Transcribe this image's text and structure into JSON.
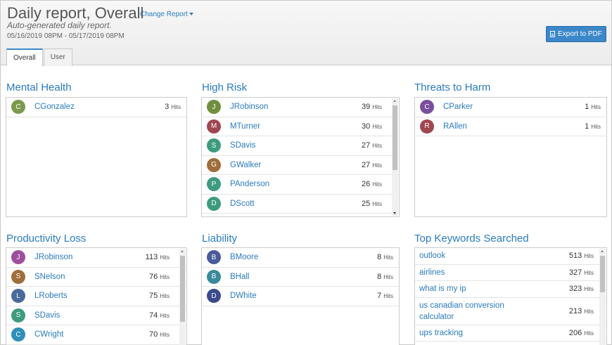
{
  "header": {
    "title": "Daily report, Overall",
    "change_report": "Change Report",
    "subtitle": "Auto-generated daily report.",
    "date_range": "05/16/2019 08PM - 05/17/2019 08PM",
    "export_label": "Export to PDF"
  },
  "tabs": [
    {
      "label": "Overall",
      "active": true
    },
    {
      "label": "User",
      "active": false
    }
  ],
  "hits_label": "Hits",
  "panels": {
    "mental_health": {
      "title": "Mental Health",
      "rows": [
        {
          "initial": "C",
          "name": "CGonzalez",
          "count": "3",
          "color": "#7a9a4e"
        }
      ]
    },
    "high_risk": {
      "title": "High Risk",
      "rows": [
        {
          "initial": "J",
          "name": "JRobinson",
          "count": "39",
          "color": "#6f8f3f"
        },
        {
          "initial": "M",
          "name": "MTurner",
          "count": "30",
          "color": "#a04650"
        },
        {
          "initial": "S",
          "name": "SDavis",
          "count": "27",
          "color": "#3d9b7e"
        },
        {
          "initial": "G",
          "name": "GWalker",
          "count": "27",
          "color": "#a06d3c"
        },
        {
          "initial": "P",
          "name": "PAnderson",
          "count": "26",
          "color": "#3d9b7e"
        },
        {
          "initial": "D",
          "name": "DScott",
          "count": "25",
          "color": "#3d9b7e"
        }
      ]
    },
    "threats": {
      "title": "Threats to Harm",
      "rows": [
        {
          "initial": "C",
          "name": "CParker",
          "count": "1",
          "color": "#7a4d9e"
        },
        {
          "initial": "R",
          "name": "RAllen",
          "count": "1",
          "color": "#a04650"
        }
      ]
    },
    "productivity": {
      "title": "Productivity Loss",
      "rows": [
        {
          "initial": "J",
          "name": "JRobinson",
          "count": "113",
          "color": "#9d4f9e"
        },
        {
          "initial": "S",
          "name": "SNelson",
          "count": "76",
          "color": "#a06d3c"
        },
        {
          "initial": "L",
          "name": "LRoberts",
          "count": "75",
          "color": "#4a6a9b"
        },
        {
          "initial": "S",
          "name": "SDavis",
          "count": "74",
          "color": "#3d9b7e"
        },
        {
          "initial": "C",
          "name": "CWright",
          "count": "70",
          "color": "#2f8fb8"
        }
      ]
    },
    "liability": {
      "title": "Liability",
      "rows": [
        {
          "initial": "B",
          "name": "BMoore",
          "count": "8",
          "color": "#4a5a9b"
        },
        {
          "initial": "B",
          "name": "BHall",
          "count": "8",
          "color": "#3a8a9b"
        },
        {
          "initial": "D",
          "name": "DWhite",
          "count": "7",
          "color": "#3b4a8e"
        }
      ]
    },
    "keywords": {
      "title": "Top Keywords Searched",
      "rows": [
        {
          "name": "outlook",
          "count": "513"
        },
        {
          "name": "airlines",
          "count": "327"
        },
        {
          "name": "what is my ip",
          "count": "323"
        },
        {
          "name": "us canadian conversion calculator",
          "count": "213"
        },
        {
          "name": "ups tracking",
          "count": "206"
        }
      ]
    }
  }
}
